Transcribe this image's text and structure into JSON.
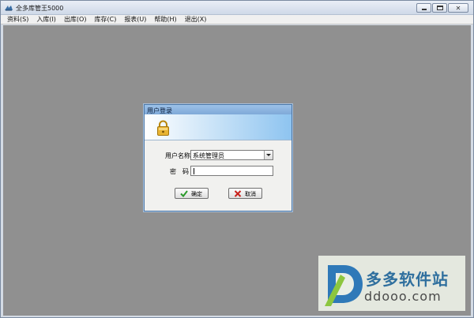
{
  "window": {
    "title": "全多库管王5000",
    "icon": "app-logo-icon",
    "controls": [
      "minimize-icon",
      "maximize-icon",
      "close-icon"
    ]
  },
  "menu": {
    "items": [
      {
        "label": "资料(S)"
      },
      {
        "label": "入库(I)"
      },
      {
        "label": "出库(O)"
      },
      {
        "label": "库存(C)"
      },
      {
        "label": "报表(U)"
      },
      {
        "label": "帮助(H)"
      },
      {
        "label": "退出(X)"
      }
    ]
  },
  "login": {
    "title": "用户登录",
    "banner_icon": "lock-icon",
    "user_label": "用户名称",
    "user_value": "系统管理员",
    "password_label": "密码",
    "password_value": "",
    "ok_label": "确定",
    "ok_icon": "checkmark-icon",
    "cancel_label": "取消",
    "cancel_icon": "x-icon"
  },
  "watermark": {
    "name": "多多软件站",
    "url": "ddooo.com"
  },
  "colors": {
    "workspace": "#909090",
    "dialog_banner": "#8ec4f0",
    "watermark_text": "#2f6f9e"
  }
}
